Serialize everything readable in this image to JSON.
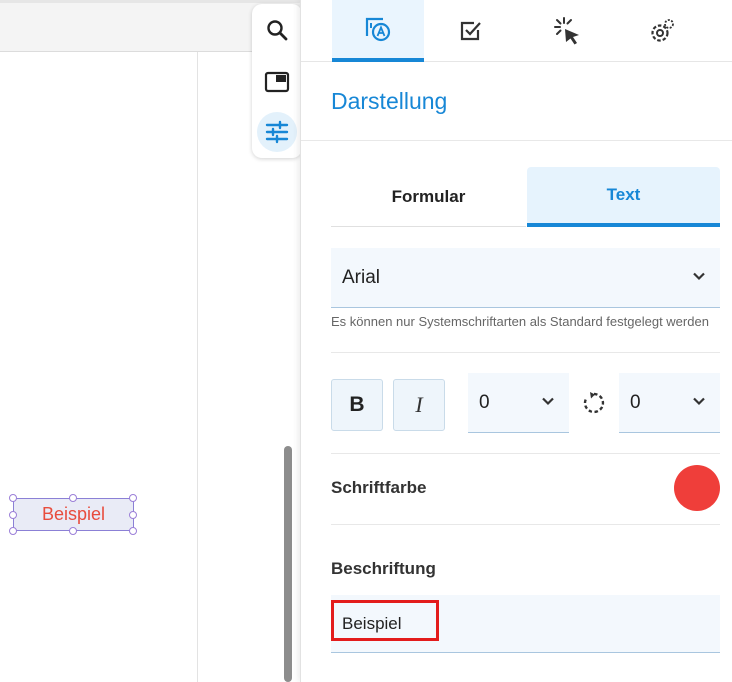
{
  "sidebar_tabs": [
    {
      "icon": "text-style-icon",
      "active": true
    },
    {
      "icon": "checkbox-icon",
      "active": false
    },
    {
      "icon": "click-icon",
      "active": false
    },
    {
      "icon": "gear-icon",
      "active": false
    }
  ],
  "mini_toolbar": [
    {
      "icon": "search-icon",
      "active": false
    },
    {
      "icon": "picture-in-picture-icon",
      "active": false
    },
    {
      "icon": "sliders-icon",
      "active": true
    }
  ],
  "panel": {
    "title": "Darstellung",
    "segments": {
      "left": "Formular",
      "right": "Text"
    },
    "font": {
      "value": "Arial",
      "hint": "Es können nur Systemschriftarten als Standard festgelegt werden"
    },
    "format": {
      "bold_label": "B",
      "italic_label": "I",
      "size_value": "0",
      "rotation_value": "0"
    },
    "font_color": {
      "label": "Schriftfarbe",
      "color": "#ef3e3a"
    },
    "caption": {
      "label": "Beschriftung",
      "value": "Beispiel"
    }
  },
  "canvas": {
    "sample_text": "Beispiel",
    "sample_text_color": "#e84c3d"
  },
  "colors": {
    "accent": "#1787d6",
    "highlight": "#e31c1c"
  }
}
